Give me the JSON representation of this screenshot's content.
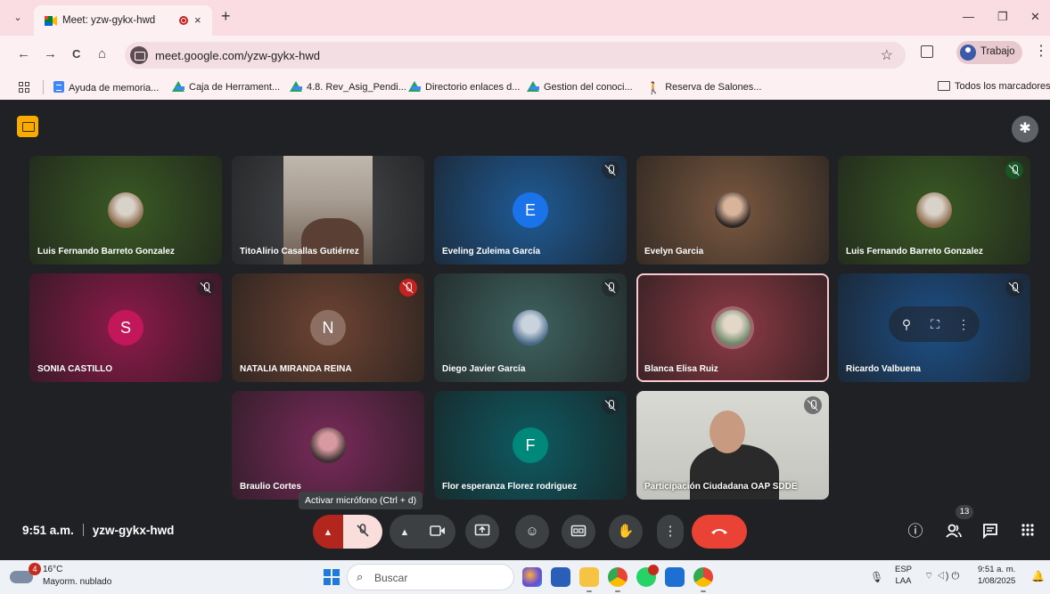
{
  "browser": {
    "tab": {
      "title": "Meet: yzw-gykx-hwd",
      "close": "×"
    },
    "new_tab": "+",
    "window": {
      "minimize": "—",
      "restore": "❐",
      "close": "✕"
    },
    "nav": {
      "back": "←",
      "forward": "→",
      "reload": "C",
      "home": "⌂"
    },
    "url": "meet.google.com/yzw-gykx-hwd",
    "profile_label": "Trabajo",
    "bookmarks": [
      "Ayuda de memoria...",
      "Caja de Herrament...",
      "4.8. Rev_Asig_Pendi...",
      "Directorio enlaces d...",
      "Gestion del conoci...",
      "Reserva de Salones..."
    ],
    "all_bookmarks": "Todos los marcadores"
  },
  "meet": {
    "participants": [
      {
        "name": "Luis Fernando Barreto Gonzalez",
        "kind": "photo",
        "bg": "#3a5a24",
        "mic": "unmuted",
        "avatar_colors": [
          "#8b6a4a",
          "#d8d2c8"
        ]
      },
      {
        "name": "TitoAlirio Casallas Gutiérrez",
        "kind": "video",
        "bg": "#4a4c50",
        "mic": "none"
      },
      {
        "name": "Eveling Zuleima García",
        "kind": "letter",
        "letter": "E",
        "bg": "#1f5b96",
        "circle": "#1a73e8",
        "mic": "muted"
      },
      {
        "name": "Evelyn Garcia",
        "kind": "photo",
        "bg": "#7a5840",
        "mic": "none",
        "avatar_colors": [
          "#2b2422",
          "#d9b49a"
        ]
      },
      {
        "name": "Luis Fernando Barreto Gonzalez",
        "kind": "photo",
        "bg": "#3a5a24",
        "mic": "muted-green",
        "avatar_colors": [
          "#8b6a4a",
          "#d8d2c8"
        ]
      },
      {
        "name": "SONIA CASTILLO",
        "kind": "letter",
        "letter": "S",
        "bg": "#8e1a4a",
        "circle": "#c2185b",
        "mic": "muted"
      },
      {
        "name": "NATALIA MIRANDA REINA",
        "kind": "letter",
        "letter": "N",
        "bg": "#6e4433",
        "circle": "#8d6e63",
        "mic": "muted-red"
      },
      {
        "name": "Diego Javier García",
        "kind": "photo",
        "bg": "#3e6360",
        "mic": "muted",
        "avatar_colors": [
          "#4a6a8a",
          "#c9d3dd"
        ]
      },
      {
        "name": "Blanca Elisa Ruiz",
        "kind": "photo",
        "bg": "#8e3a44",
        "mic": "none",
        "speaking": true,
        "avatar_colors": [
          "#6d8a6a",
          "#e2d7c9"
        ]
      },
      {
        "name": "Ricardo Valbuena",
        "kind": "hover",
        "bg": "#1d4f86",
        "mic": "muted"
      },
      {
        "name": "Braulio Cortes",
        "kind": "photo",
        "bg": "#7a2a5a",
        "mic": "none",
        "avatar_colors": [
          "#3b3030",
          "#d79aa0"
        ]
      },
      {
        "name": "Flor esperanza Florez rodriguez",
        "kind": "letter",
        "letter": "F",
        "bg": "#0e5a62",
        "circle": "#00897b",
        "mic": "muted"
      },
      {
        "name": "Participación Ciudadana OAP SDDE",
        "kind": "video2",
        "bg": "#c9c9c4",
        "mic": "muted"
      }
    ],
    "hover_controls": [
      "pin-icon",
      "frame-icon",
      "more-vert-icon"
    ],
    "tooltip": "Activar micrófono (Ctrl + d)",
    "time": "9:51 a.m.",
    "meeting_code": "yzw-gykx-hwd",
    "people_count": "13",
    "colors": {
      "end_call": "#ea4335",
      "mic_off": "#f9dedc",
      "mic_chevron": "#b3261e",
      "meet_bg": "#202124",
      "tab_strip": "#f9dde3"
    }
  },
  "taskbar": {
    "weather_temp": "16°C",
    "weather_desc": "Mayorm. nublado",
    "weather_badge": "4",
    "search_placeholder": "Buscar",
    "lang_top": "ESP",
    "lang_bottom": "LAA",
    "time": "9:51 a. m.",
    "date": "1/08/2025"
  }
}
